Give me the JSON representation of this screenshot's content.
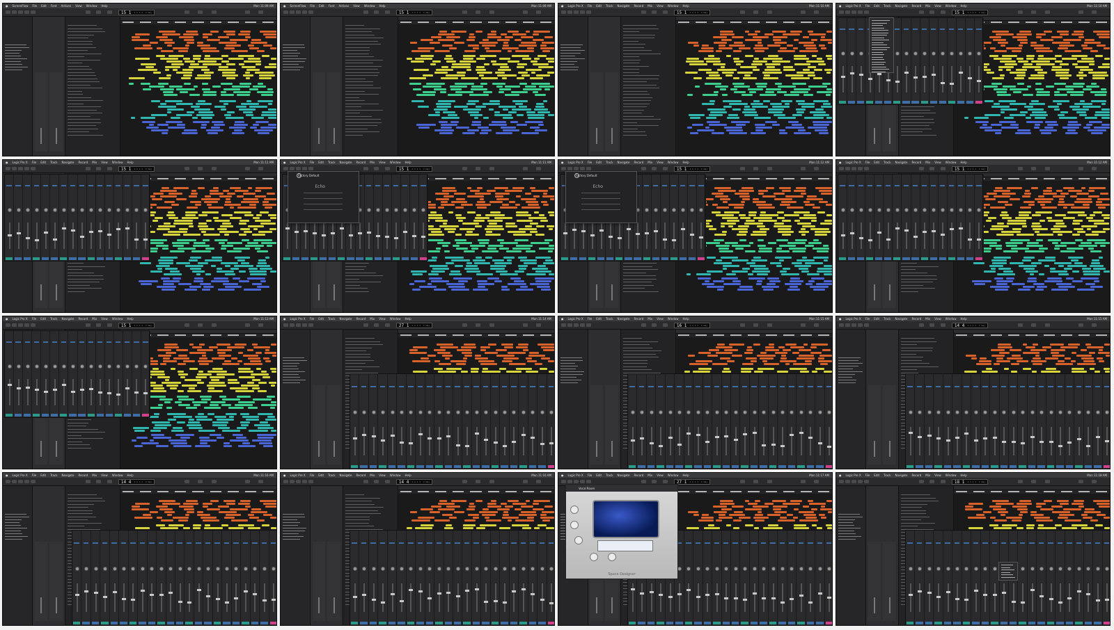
{
  "sheet": {
    "columns": 4,
    "rows": 4
  },
  "colors": {
    "region_orange": "#d9622b",
    "region_yellow": "#d6d43a",
    "region_green": "#3ccf8e",
    "region_teal": "#2fb7b0",
    "region_blue": "#4a66d6",
    "mixer_blue": "#3e6ea8",
    "mixer_teal": "#2a9a8a",
    "mixer_pink": "#d0408c"
  },
  "frames": [
    {
      "app": "ScreenFlow",
      "menus": [
        "File",
        "Edit",
        "Font",
        "Actions",
        "View",
        "Window",
        "Help"
      ],
      "clock": "Mon 11:09 AM",
      "lcd_main": "15  1",
      "lcd_bars": "1 1 1 1",
      "lcd_extra": "C maj",
      "mode": "arrange",
      "overlay": "none"
    },
    {
      "app": "ScreenFlow",
      "menus": [
        "File",
        "Edit",
        "Font",
        "Actions",
        "View",
        "Window",
        "Help"
      ],
      "clock": "Mon 11:09 AM",
      "lcd_main": "15  1",
      "lcd_bars": "1 1 1 1",
      "lcd_extra": "C maj",
      "mode": "arrange",
      "overlay": "none"
    },
    {
      "app": "Logic Pro X",
      "menus": [
        "File",
        "Edit",
        "Track",
        "Navigate",
        "Record",
        "Mix",
        "View",
        "Window",
        "Help"
      ],
      "clock": "Mon 11:10 AM",
      "lcd_main": "15  1",
      "lcd_bars": "1 1 1 1",
      "lcd_extra": "C maj",
      "mode": "arrange",
      "overlay": "none"
    },
    {
      "app": "Logic Pro X",
      "menus": [
        "File",
        "Edit",
        "Track",
        "Navigate",
        "Record",
        "Mix",
        "View",
        "Window",
        "Help"
      ],
      "clock": "Mon 11:10 AM",
      "lcd_main": "15  1",
      "lcd_bars": "1 1 1 1",
      "lcd_extra": "C maj",
      "mode": "mixer-float",
      "overlay": "menu"
    },
    {
      "app": "Logic Pro X",
      "menus": [
        "File",
        "Edit",
        "Track",
        "Navigate",
        "Record",
        "Mix",
        "View",
        "Window",
        "Help"
      ],
      "clock": "Mon 11:11 AM",
      "lcd_main": "15  1",
      "lcd_bars": "1 1 1 1",
      "lcd_extra": "C maj",
      "mode": "mixer-float",
      "overlay": "none"
    },
    {
      "app": "Logic Pro X",
      "menus": [
        "File",
        "Edit",
        "Track",
        "Navigate",
        "Record",
        "Mix",
        "View",
        "Window",
        "Help"
      ],
      "clock": "Mon 11:11 AM",
      "lcd_main": "15  1",
      "lcd_bars": "1 1 1 1",
      "lcd_extra": "C maj",
      "mode": "mixer-float",
      "overlay": "plugin",
      "plugin_title": "Factory Default",
      "plugin_name": "Echo"
    },
    {
      "app": "Logic Pro X",
      "menus": [
        "File",
        "Edit",
        "Track",
        "Navigate",
        "Record",
        "Mix",
        "View",
        "Window",
        "Help"
      ],
      "clock": "Mon 11:12 AM",
      "lcd_main": "15  1",
      "lcd_bars": "1 1 1 1",
      "lcd_extra": "C maj",
      "mode": "mixer-float",
      "overlay": "plugin",
      "plugin_title": "Factory Default",
      "plugin_name": "Echo"
    },
    {
      "app": "Logic Pro X",
      "menus": [
        "File",
        "Edit",
        "Track",
        "Navigate",
        "Record",
        "Mix",
        "View",
        "Window",
        "Help"
      ],
      "clock": "Mon 11:12 AM",
      "lcd_main": "15  1",
      "lcd_bars": "1 1 1 1",
      "lcd_extra": "C maj",
      "mode": "mixer-float",
      "overlay": "none"
    },
    {
      "app": "Logic Pro X",
      "menus": [
        "File",
        "Edit",
        "Track",
        "Navigate",
        "Record",
        "Mix",
        "View",
        "Window",
        "Help"
      ],
      "clock": "Mon 11:13 AM",
      "lcd_main": "15  1",
      "lcd_bars": "1 1 1 1",
      "lcd_extra": "C maj",
      "mode": "mixer-float",
      "overlay": "none"
    },
    {
      "app": "Logic Pro X",
      "menus": [
        "File",
        "Edit",
        "Track",
        "Navigate",
        "Record",
        "Mix",
        "View",
        "Window",
        "Help"
      ],
      "clock": "Mon 11:14 AM",
      "lcd_main": "27  1",
      "lcd_bars": "1 1 1 1",
      "lcd_extra": "C maj",
      "mode": "mixer-bottom",
      "overlay": "none"
    },
    {
      "app": "Logic Pro X",
      "menus": [
        "File",
        "Edit",
        "Track",
        "Navigate",
        "Record",
        "Mix",
        "View",
        "Window",
        "Help"
      ],
      "clock": "Mon 11:15 AM",
      "lcd_main": "16  1",
      "lcd_bars": "1 1 1 1",
      "lcd_extra": "C maj",
      "mode": "mixer-bottom",
      "overlay": "none"
    },
    {
      "app": "Logic Pro X",
      "menus": [
        "File",
        "Edit",
        "Track",
        "Navigate",
        "Record",
        "Mix",
        "View",
        "Window",
        "Help"
      ],
      "clock": "Mon 11:15 AM",
      "lcd_main": "14  4",
      "lcd_bars": "1 1 1 1",
      "lcd_extra": "C maj",
      "mode": "mixer-bottom",
      "overlay": "none"
    },
    {
      "app": "Logic Pro X",
      "menus": [
        "File",
        "Edit",
        "Track",
        "Navigate",
        "Record",
        "Mix",
        "View",
        "Window",
        "Help"
      ],
      "clock": "Mon 11:16 AM",
      "lcd_main": "14  4",
      "lcd_bars": "1 1 1 1",
      "lcd_extra": "C maj",
      "mode": "mixer-bottom",
      "overlay": "none"
    },
    {
      "app": "Logic Pro X",
      "menus": [
        "File",
        "Edit",
        "Track",
        "Navigate",
        "Record",
        "Mix",
        "View",
        "Window",
        "Help"
      ],
      "clock": "Mon 11:16 AM",
      "lcd_main": "14  4",
      "lcd_bars": "1 1 1 1",
      "lcd_extra": "C maj",
      "mode": "mixer-bottom",
      "overlay": "none"
    },
    {
      "app": "Logic Pro X",
      "menus": [
        "File",
        "Edit",
        "Track",
        "Navigate",
        "Record",
        "Mix",
        "View",
        "Window",
        "Help"
      ],
      "clock": "Mon 11:17 AM",
      "lcd_main": "27  1",
      "lcd_bars": "1 1 1 1",
      "lcd_extra": "C maj",
      "mode": "mixer-bottom",
      "overlay": "space-designer",
      "plugin_title": "Vocal Room",
      "plugin_name": "Space Designer"
    },
    {
      "app": "Logic Pro X",
      "menus": [
        "File",
        "Edit",
        "Track",
        "Navigate",
        "Record",
        "Mix",
        "View",
        "Window",
        "Help"
      ],
      "clock": "Mon 11:18 AM",
      "lcd_main": "18  1",
      "lcd_bars": "1 1 1 1",
      "lcd_extra": "C maj",
      "mode": "mixer-bottom",
      "overlay": "menu"
    }
  ]
}
